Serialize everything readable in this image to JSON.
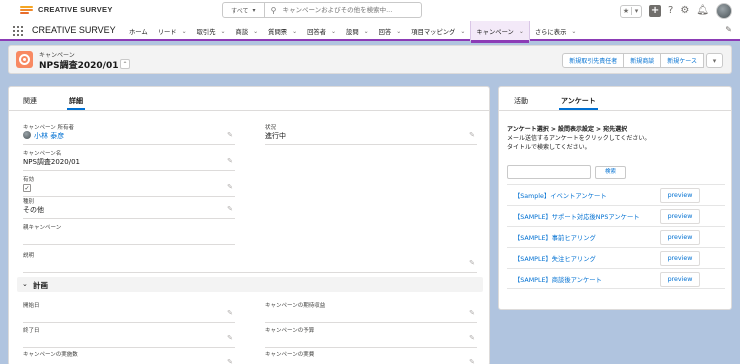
{
  "header": {
    "logo_text": "CREATIVE SURVEY",
    "search_scope": "すべて",
    "search_placeholder": "キャンペーンおよびその他を検索中..."
  },
  "nav": {
    "app_name": "CREATIVE SURVEY",
    "items": [
      {
        "label": "ホーム",
        "has_menu": false
      },
      {
        "label": "リード",
        "has_menu": true
      },
      {
        "label": "取引先",
        "has_menu": true
      },
      {
        "label": "商談",
        "has_menu": true
      },
      {
        "label": "質問票",
        "has_menu": true
      },
      {
        "label": "回答者",
        "has_menu": true
      },
      {
        "label": "設問",
        "has_menu": true
      },
      {
        "label": "回答",
        "has_menu": true
      },
      {
        "label": "項目マッピング",
        "has_menu": true
      },
      {
        "label": "キャンペーン",
        "has_menu": true,
        "active": true
      },
      {
        "label": "さらに表示",
        "has_menu": true
      }
    ]
  },
  "record": {
    "type_label": "キャンペーン",
    "title": "NPS調査2020/01",
    "actions": [
      "新規取引先責任者",
      "新規商談",
      "新規ケース"
    ]
  },
  "left_tabs": [
    "関連",
    "詳細"
  ],
  "details": {
    "owner": {
      "label": "キャンペーン 所有者",
      "value": "小林 泰彦"
    },
    "status": {
      "label": "状況",
      "value": "進行中"
    },
    "name": {
      "label": "キャンペーン名",
      "value": "NPS調査2020/01"
    },
    "active": {
      "label": "有効",
      "value": "✓"
    },
    "type": {
      "label": "種別",
      "value": "その他"
    },
    "parent": {
      "label": "親キャンペーン",
      "value": ""
    },
    "description": {
      "label": "説明",
      "value": ""
    }
  },
  "plan_section": {
    "title": "計画",
    "fields": {
      "start_date": "開始日",
      "expected_revenue": "キャンペーンの期待収益",
      "end_date": "終了日",
      "budget": "キャンペーンの予算",
      "num_sent": "キャンペーンの実施数",
      "actual_cost": "キャンペーンの実費"
    }
  },
  "right_tabs": [
    "活動",
    "アンケート"
  ],
  "survey": {
    "instruction_line1": "アンケート選択 > 設問表示設定 > 宛先選択",
    "instruction_line2": "メール送信するアンケートをクリックしてください。",
    "instruction_line3": "タイトルで検索してください。",
    "search_button": "検索",
    "preview_label": "preview",
    "items": [
      "【Sample】イベントアンケート",
      "【SAMPLE】サポート対応後NPSアンケート",
      "【SAMPLE】事前ヒアリング",
      "【SAMPLE】失注ヒアリング",
      "【SAMPLE】商談後アンケート"
    ]
  },
  "colors": {
    "accent": "#8c3bb5",
    "link": "#0070d2",
    "campaign_icon": "#f88962",
    "background": "#b0c4df"
  }
}
